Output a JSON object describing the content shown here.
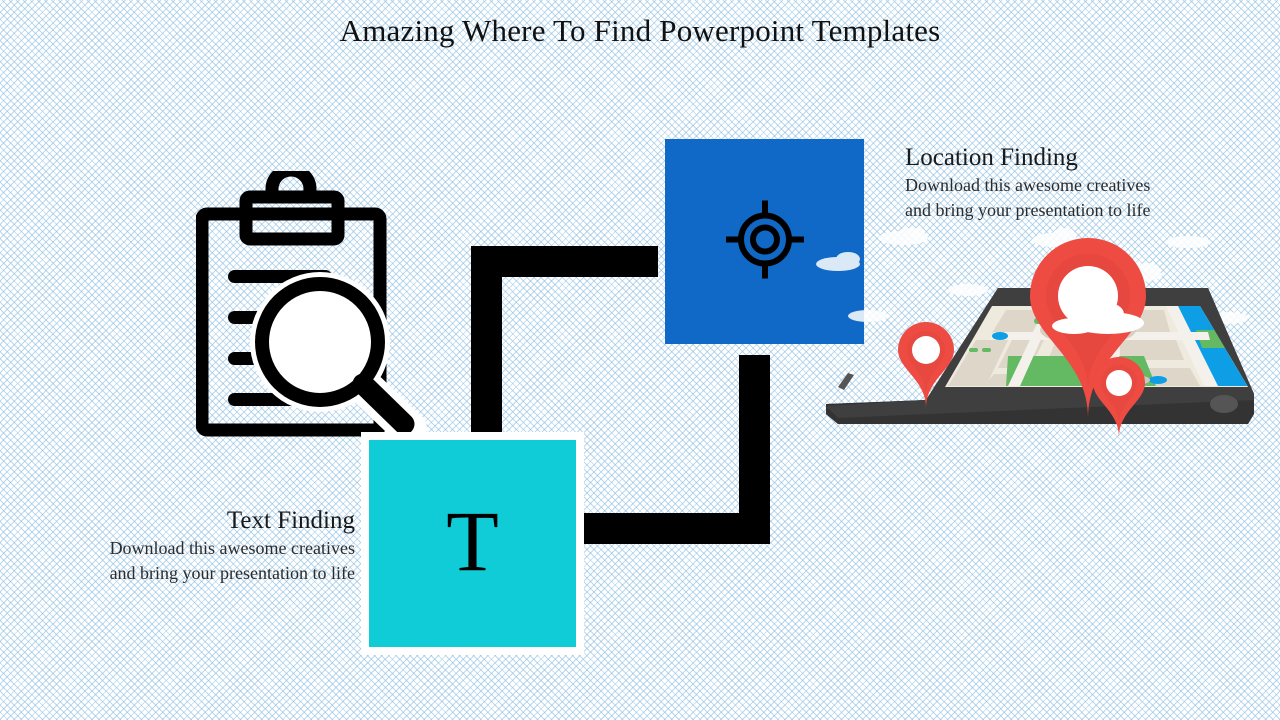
{
  "slide": {
    "title": "Amazing Where To Find Powerpoint Templates",
    "background_color": "#ffffff",
    "pattern_color": "#82b9e1"
  },
  "connectors": {
    "color": "#000000",
    "elbow_top_left_name": "elbow-connector-upper",
    "elbow_bottom_right_name": "elbow-connector-lower"
  },
  "nodes": [
    {
      "id": "location",
      "icon_name": "target-crosshair-icon",
      "square_color": "#1069c6",
      "icon_color": "#000000",
      "heading": "Location Finding",
      "body_line_1": "Download this awesome creatives",
      "body_line_2": "and bring your presentation to life"
    },
    {
      "id": "text",
      "icon_name": "letter-t-icon",
      "icon_glyph": "T",
      "square_color": "#0fccd6",
      "icon_color": "#000000",
      "heading": "Text Finding",
      "body_line_1": "Download this awesome creatives",
      "body_line_2": "and bring your presentation to life"
    }
  ],
  "illustrations": {
    "clipboard": {
      "name": "clipboard-with-magnifier-illustration",
      "color": "#000000"
    },
    "phone_map": {
      "name": "smartphone-map-with-pins-illustration",
      "phone_body_color": "#3f3f3f",
      "phone_body_dark_color": "#333333",
      "map_base_color": "#e8e2d8",
      "map_road_color": "#f4f1ec",
      "map_park_color": "#63ba63",
      "map_water_color": "#0e9ee5",
      "pin_color": "#ee4b42",
      "pin_dark_color": "#e0463d",
      "cloud_color": "#ffffff",
      "pin_count": 3
    }
  }
}
